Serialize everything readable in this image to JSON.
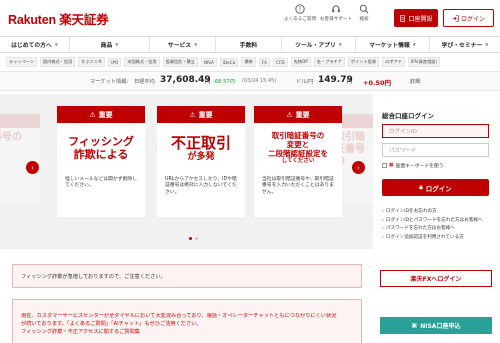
{
  "header": {
    "logo_text": "Rakuten 楽天証券",
    "faq_label": "よくあるご質問",
    "support_label": "お客様サポート",
    "search_label": "検索",
    "open_account_label": "口座開設",
    "login_label": "ログイン"
  },
  "nav": {
    "items": [
      {
        "label": "はじめての方へ",
        "caret": true
      },
      {
        "label": "商品",
        "caret": true
      },
      {
        "label": "サービス",
        "caret": true
      },
      {
        "label": "手数料",
        "caret": false
      },
      {
        "label": "ツール・アプリ",
        "caret": true
      },
      {
        "label": "マーケット情報",
        "caret": true
      },
      {
        "label": "学び・セミナー",
        "caret": true
      }
    ]
  },
  "subnav": {
    "items": [
      "キャンペーン",
      "国内株式・信用",
      "かぶミニ®",
      "IPO",
      "米国株式・信用",
      "投資信託・積立",
      "NISA",
      "iDeCo",
      "債券",
      "FX",
      "CFD",
      "先物OP",
      "金・プラチナ",
      "ポイント投資",
      "ロボアド",
      "IFA(資産相談)"
    ]
  },
  "ticker": {
    "label": "マーケット情報：",
    "nikkei_label": "日経平均",
    "nikkei_value": "37,608.49",
    "nikkei_unit": "円",
    "nikkei_change": "-68.57円",
    "nikkei_time": "(03/24 15:45)",
    "usd_label": "ドル/円",
    "usd_value": "149.79",
    "usd_unit": "円",
    "usd_change": "+0.50円",
    "detail_label": "詳細"
  },
  "carousel": {
    "badge_label": "重要",
    "cards": [
      {
        "line1": "フィッシング",
        "line2": "詐欺による",
        "body": "怪しいメールなどは開かず削除してください。"
      },
      {
        "line1": "不正取引",
        "line2": "が多発",
        "body": "URLからアクセスしたり、IDや暗証番号は絶対に入力しないでください。"
      },
      {
        "line1": "取引暗証番号の",
        "line2": "変更と",
        "line3": "二段階認証設定を",
        "line4": "してください",
        "body": "当社は取引暗証番号や、取引暗証番号を入力いただくことはありません。"
      }
    ],
    "ghost_left": "口座番号の",
    "ghost_right": "取引暗証番号の"
  },
  "login_box": {
    "title": "総合口座ログイン",
    "id_placeholder": "ログインID",
    "password_placeholder": "パスワード",
    "keyboard_label": "画面キーボードを使う",
    "login_button": "ログイン",
    "links": [
      "ログインIDをお忘れの方",
      "ログインIDとパスワードを忘れた方はお客様へ",
      "パスワードを忘れた方はお客様へ",
      "ログイン追加認証を利用されている方"
    ]
  },
  "notices": {
    "phishing": "フィッシング詐欺が急増しておりますので、ご注意ください。",
    "support_line1": "現在、カスタマーサービスセンターが全ダイヤルにおいて大変混み合っており、電話・オペレーターチャットともにつながりにくい状況",
    "support_line2": "が続いております。「よくあるご質問」「AIチャット」もぜひご活用ください。",
    "support_line3": "フィッシング詐欺・不正アクセスに関するご質問集"
  },
  "side": {
    "fx_login": "楽天FXへログイン",
    "nisa_label": "NISA口座申込"
  },
  "colors": {
    "brand_red": "#bf0000",
    "teal": "#2aa198",
    "down": "#1a9e3f",
    "up": "#bf0000"
  }
}
